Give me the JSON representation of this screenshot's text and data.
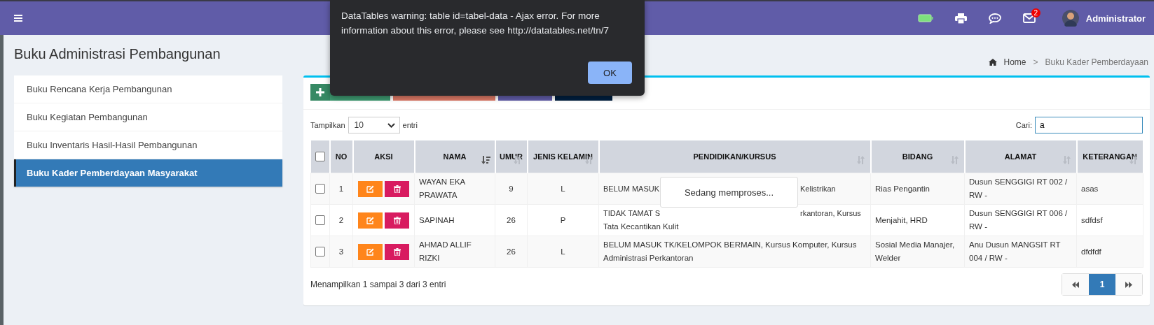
{
  "header": {
    "notification_count": "2",
    "user_name": "Administrator"
  },
  "dialog": {
    "message": "DataTables warning: table id=tabel-data - Ajax error. For more information about this error, please see http://datatables.net/tn/7",
    "button": "OK"
  },
  "page_title": "Buku Administrasi Pembangunan",
  "breadcrumb": {
    "items": [
      "Home",
      "Buku Kader Pemberdayaan"
    ],
    "separator": ">"
  },
  "sidebar": {
    "items": [
      {
        "label": "Buku Rencana Kerja Pembangunan",
        "selected": false
      },
      {
        "label": "Buku Kegiatan Pembangunan",
        "selected": false
      },
      {
        "label": "Buku Inventaris Hasil-Hasil Pembangunan",
        "selected": false
      },
      {
        "label": "Buku Kader Pemberdayaan Masyarakat",
        "selected": true
      }
    ]
  },
  "toolbar": [
    {
      "kind": "add",
      "color": "#3d9970"
    },
    {
      "kind": "plain",
      "color": "#dd7966"
    },
    {
      "kind": "plain",
      "color": "#605ca8"
    },
    {
      "kind": "plain",
      "color": "#001f3f"
    }
  ],
  "length": {
    "before": "Tampilkan",
    "value": "10",
    "after": "entri"
  },
  "search": {
    "label": "Cari:",
    "value": "a"
  },
  "table": {
    "select_all_checked": false,
    "columns": [
      {
        "label": "NO",
        "kind": "plain"
      },
      {
        "label": "AKSI",
        "kind": "plain"
      },
      {
        "label": "NAMA",
        "kind": "sorted"
      },
      {
        "label": "UMUR",
        "kind": "sortable"
      },
      {
        "label": "JENIS KELAMIN",
        "kind": "sortable"
      },
      {
        "label": "PENDIDIKAN/KURSUS",
        "kind": "sortable"
      },
      {
        "label": "BIDANG",
        "kind": "sortable"
      },
      {
        "label": "ALAMAT",
        "kind": "sortable"
      },
      {
        "label": "KETERANGAN",
        "kind": "sortable"
      }
    ],
    "rows": [
      {
        "checked": false,
        "no": "1",
        "nama": "WAYAN EKA PRAWATA",
        "umur": "9",
        "jenis_kelamin": "L",
        "pendidikan_lines": [
          [
            "BELUM MASUK",
            "Kelistrikan"
          ]
        ],
        "bidang": "Rias Pengantin",
        "alamat": "Dusun SENGGIGI RT 002 / RW -",
        "keterangan": "asas"
      },
      {
        "checked": false,
        "no": "2",
        "nama": "SAPINAH",
        "umur": "26",
        "jenis_kelamin": "P",
        "pendidikan_lines": [
          [
            "TIDAK TAMAT S",
            "rkantoran, Kursus"
          ],
          [
            "Tata Kecantikan Kulit"
          ]
        ],
        "bidang": "Menjahit, HRD",
        "alamat": "Dusun SENGGIGI RT 006 / RW -",
        "keterangan": "sdfdsf"
      },
      {
        "checked": false,
        "no": "3",
        "nama": "AHMAD ALLIF RIZKI",
        "umur": "26",
        "jenis_kelamin": "L",
        "pendidikan_lines": [
          [
            "BELUM MASUK TK/KELOMPOK BERMAIN, Kursus Komputer, Kursus Administrasi Perkantoran"
          ]
        ],
        "bidang": "Sosial Media Manajer, Welder",
        "alamat": "Anu Dusun MANGSIT RT 004 / RW -",
        "keterangan": "dfdfdf"
      }
    ]
  },
  "processing": "Sedang memproses...",
  "info": "Menampilkan 1 sampai 3 dari 3 entri",
  "pagination": [
    {
      "kind": "prev",
      "selected": false
    },
    {
      "kind": "page",
      "label": "1",
      "selected": true
    },
    {
      "kind": "next",
      "selected": false
    }
  ]
}
